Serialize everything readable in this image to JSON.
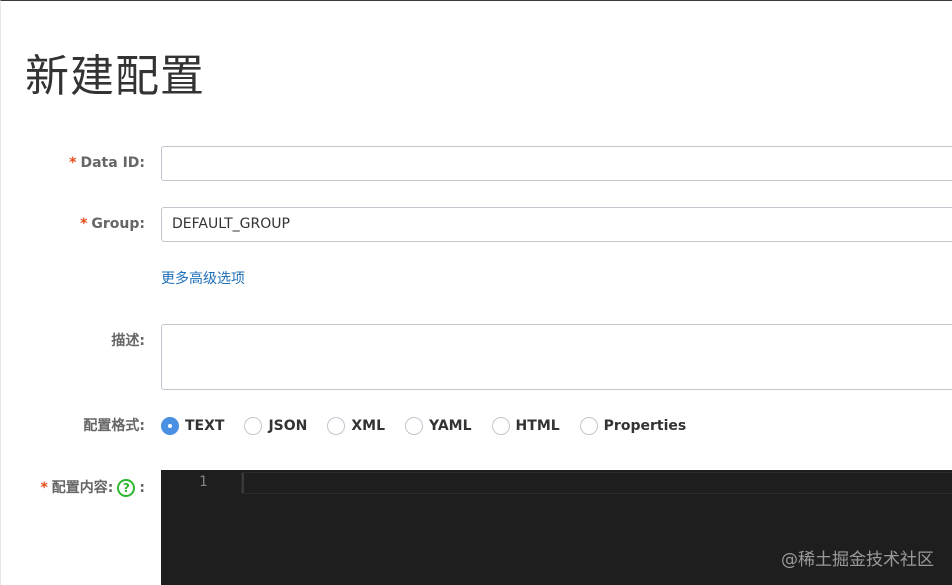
{
  "page": {
    "title": "新建配置"
  },
  "form": {
    "data_id": {
      "required_mark": "*",
      "label": "Data ID:",
      "value": ""
    },
    "group": {
      "required_mark": "*",
      "label": "Group:",
      "value": "DEFAULT_GROUP"
    },
    "advanced_link": "更多高级选项",
    "description": {
      "label": "描述:",
      "value": ""
    },
    "format": {
      "label": "配置格式:",
      "selected": "TEXT",
      "options": [
        "TEXT",
        "JSON",
        "XML",
        "YAML",
        "HTML",
        "Properties"
      ]
    },
    "content": {
      "required_mark": "*",
      "label": "配置内容:",
      "help_icon": "question-circle-icon",
      "help_glyph": "?",
      "colon": ":",
      "editor": {
        "line_numbers": [
          "1"
        ],
        "value": ""
      }
    }
  },
  "watermark": "@稀土掘金技术社区",
  "colors": {
    "required": "#e64a19",
    "link": "#1f6fb8",
    "radio_checked": "#4a90e2",
    "help_icon": "#2eb82e",
    "editor_bg": "#1e1e1e"
  }
}
